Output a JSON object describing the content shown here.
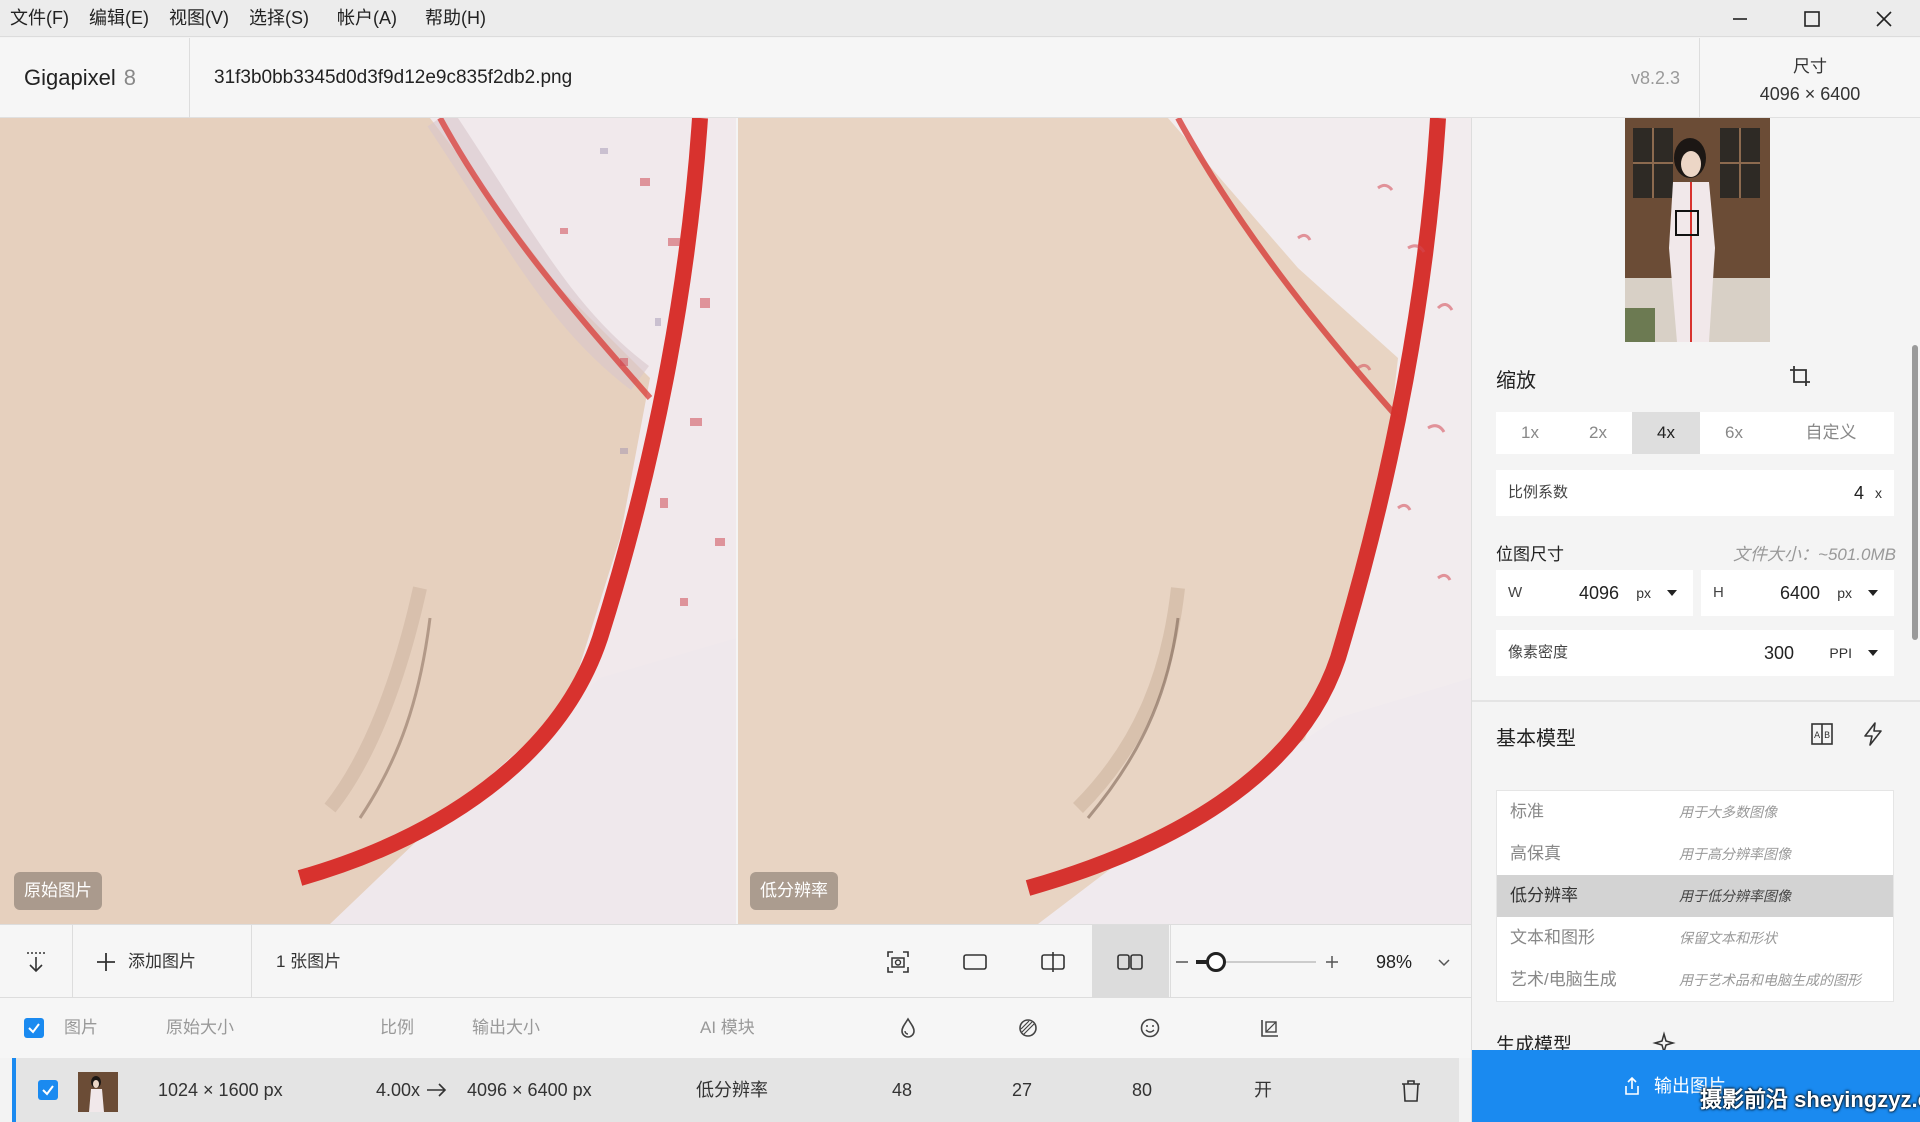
{
  "menu": [
    "文件(F)",
    "编辑(E)",
    "视图(V)",
    "选择(S)",
    "帐户(A)",
    "帮助(H)"
  ],
  "app": {
    "name": "Gigapixel",
    "version_num": "8",
    "file_name": "31f3b0bb3345d0d3f9d12e9c835f2db2.png",
    "version": "v8.2.3"
  },
  "dims": {
    "label": "尺寸",
    "value": "4096 × 6400"
  },
  "preview": {
    "left_label": "原始图片",
    "right_label": "低分辨率"
  },
  "scale": {
    "title": "缩放",
    "tabs": [
      "1x",
      "2x",
      "4x",
      "6x",
      "自定义"
    ],
    "active_tab": "4x",
    "factor_label": "比例系数",
    "factor_value": "4",
    "factor_unit": "x"
  },
  "bitmap": {
    "title": "位图尺寸",
    "file_size": "文件大小：~501.0MB",
    "w_label": "W",
    "w_value": "4096",
    "w_unit": "px",
    "h_label": "H",
    "h_value": "6400",
    "h_unit": "px",
    "ppi_label": "像素密度",
    "ppi_value": "300",
    "ppi_unit": "PPI"
  },
  "base_model": {
    "title": "基本模型",
    "models": [
      {
        "name": "标准",
        "desc": "用于大多数图像",
        "active": false
      },
      {
        "name": "高保真",
        "desc": "用于高分辨率图像",
        "active": false
      },
      {
        "name": "低分辨率",
        "desc": "用于低分辨率图像",
        "active": true
      },
      {
        "name": "文本和图形",
        "desc": "保留文本和形状",
        "active": false
      },
      {
        "name": "艺术/电脑生成",
        "desc": "用于艺术品和电脑生成的图形",
        "active": false
      }
    ]
  },
  "gen_model": {
    "title": "生成模型"
  },
  "export": {
    "label": "输出图片"
  },
  "watermark": "摄影前沿 sheyingzyz.com",
  "toolbar": {
    "add_label": "添加图片",
    "count": "1 张图片",
    "zoom": "98%",
    "zoom_level": 0.2
  },
  "table": {
    "headers": {
      "image": "图片",
      "original": "原始大小",
      "ratio": "比例",
      "output": "输出大小",
      "ai": "AI 模块"
    },
    "row": {
      "original": "1024 × 1600 px",
      "ratio": "4.00x",
      "output": "4096 × 6400 px",
      "ai": "低分辨率",
      "v1": "48",
      "v2": "27",
      "v3": "80",
      "v4": "开"
    }
  },
  "colors": {
    "accent": "#1a8af0",
    "skin": "#e8d3c2",
    "dress_red": "#d8322e"
  }
}
